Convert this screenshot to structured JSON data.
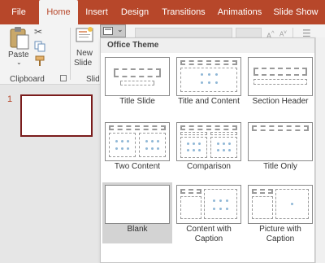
{
  "tabs": [
    {
      "label": "File"
    },
    {
      "label": "Home"
    },
    {
      "label": "Insert"
    },
    {
      "label": "Design"
    },
    {
      "label": "Transitions"
    },
    {
      "label": "Animations"
    },
    {
      "label": "Slide Show"
    }
  ],
  "ribbon": {
    "paste_label": "Paste",
    "clipboard_label": "Clipboard",
    "new_slide_label": "New",
    "new_slide_label2": "Slide",
    "slides_group_label": "Slid"
  },
  "slides_pane": {
    "slide_number": "1"
  },
  "gallery": {
    "title": "Office Theme",
    "layouts": [
      {
        "label": "Title Slide",
        "selected": false
      },
      {
        "label": "Title and Content",
        "selected": false
      },
      {
        "label": "Section Header",
        "selected": false
      },
      {
        "label": "Two Content",
        "selected": false
      },
      {
        "label": "Comparison",
        "selected": false
      },
      {
        "label": "Title Only",
        "selected": false
      },
      {
        "label": "Blank",
        "selected": true
      },
      {
        "label": "Content with\nCaption",
        "selected": false
      },
      {
        "label": "Picture with\nCaption",
        "selected": false
      }
    ]
  },
  "colors": {
    "accent": "#b7472a",
    "slide_border": "#7a1c1c",
    "placeholder_dot": "#8fb7d6"
  }
}
